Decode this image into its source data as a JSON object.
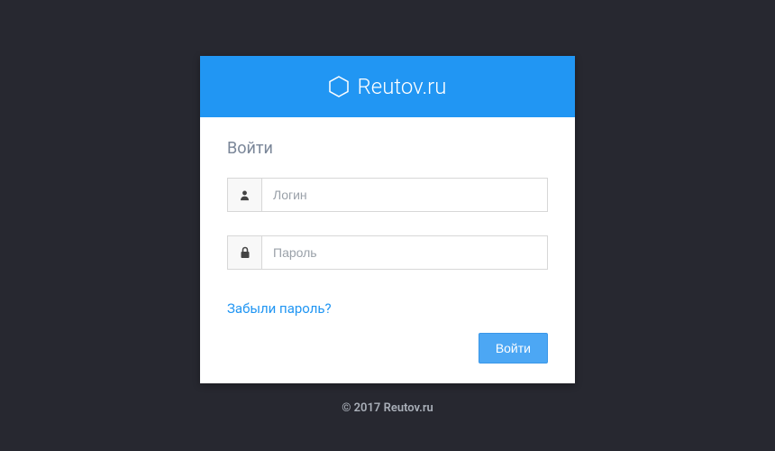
{
  "header": {
    "site_title": "Reutov.ru"
  },
  "form": {
    "title": "Войти",
    "login_placeholder": "Логин",
    "login_value": "",
    "password_placeholder": "Пароль",
    "password_value": "",
    "forgot_label": "Забыли пароль?",
    "submit_label": "Войти"
  },
  "footer": {
    "copyright": "© 2017 Reutov.ru"
  },
  "colors": {
    "accent": "#2196f3",
    "background": "#272830"
  }
}
